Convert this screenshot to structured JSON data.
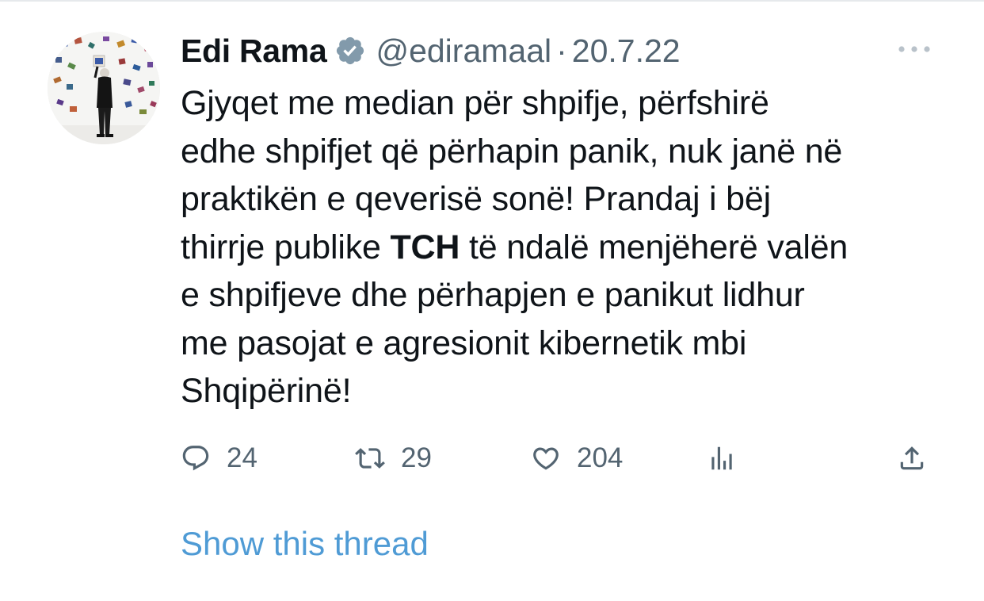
{
  "author": {
    "name": "Edi Rama",
    "handle": "@ediramaal",
    "separator": "·",
    "date": "20.7.22",
    "verified": true
  },
  "tweet": {
    "lines": [
      {
        "parts": [
          {
            "text": "Gjyqet me median për shpifje, përfshirë",
            "bold": false
          }
        ]
      },
      {
        "parts": [
          {
            "text": "edhe shpifjet që përhapin panik, nuk janë në",
            "bold": false
          }
        ]
      },
      {
        "parts": [
          {
            "text": "praktikën e qeverisë sonë! Prandaj i bëj",
            "bold": false
          }
        ]
      },
      {
        "parts": [
          {
            "text": "thirrje publike ",
            "bold": false
          },
          {
            "text": "TCH",
            "bold": true
          },
          {
            "text": " të ndalë menjëherë valën",
            "bold": false
          }
        ]
      },
      {
        "parts": [
          {
            "text": "e shpifjeve dhe përhapjen e panikut lidhur",
            "bold": false
          }
        ]
      },
      {
        "parts": [
          {
            "text": "me pasojat e agresionit kibernetik mbi",
            "bold": false
          }
        ]
      },
      {
        "parts": [
          {
            "text": "Shqipërinë!",
            "bold": false
          }
        ]
      }
    ]
  },
  "actions": {
    "reply": {
      "icon": "reply-icon",
      "count": "24"
    },
    "retweet": {
      "icon": "retweet-icon",
      "count": "29"
    },
    "like": {
      "icon": "heart-icon",
      "count": "204"
    },
    "views": {
      "icon": "analytics-icon"
    },
    "share": {
      "icon": "share-icon"
    }
  },
  "show_thread": "Show this thread",
  "colors": {
    "text": "#0f1419",
    "secondary": "#536471",
    "link": "#4f9bd5",
    "verified_badge": "#829aab"
  }
}
